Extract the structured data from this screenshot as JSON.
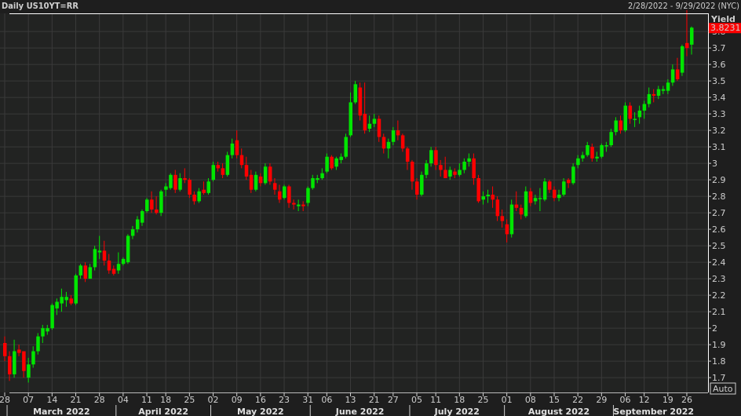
{
  "header": {
    "title": "Daily US10YT=RR",
    "range": "2/28/2022 - 9/29/2022 (NYC)"
  },
  "chart_data": {
    "type": "candlestick",
    "ylabel": "Yield",
    "ylim": [
      1.61,
      3.91
    ],
    "yticks": [
      1.7,
      1.8,
      1.9,
      2,
      2.1,
      2.2,
      2.3,
      2.4,
      2.5,
      2.6,
      2.7,
      2.8,
      2.9,
      3,
      3.1,
      3.2,
      3.3,
      3.4,
      3.5,
      3.6,
      3.7,
      3.8
    ],
    "last_value": "3.8231",
    "scale_mode": "Auto",
    "colors": {
      "up": "#00e600",
      "down": "#ff0000",
      "last_badge": "#ff0000",
      "grid": "#3a3a3a",
      "plot_bg": "#222322"
    },
    "grid": true,
    "columns": [
      "date",
      "open",
      "high",
      "low",
      "close"
    ],
    "candles": [
      [
        "2022-02-28",
        1.91,
        1.95,
        1.8,
        1.83
      ],
      [
        "2022-03-01",
        1.83,
        1.86,
        1.68,
        1.72
      ],
      [
        "2022-03-02",
        1.72,
        1.93,
        1.7,
        1.86
      ],
      [
        "2022-03-03",
        1.87,
        1.9,
        1.83,
        1.85
      ],
      [
        "2022-03-04",
        1.86,
        1.86,
        1.7,
        1.74
      ],
      [
        "2022-03-07",
        1.7,
        1.82,
        1.67,
        1.78
      ],
      [
        "2022-03-08",
        1.78,
        1.89,
        1.76,
        1.86
      ],
      [
        "2022-03-09",
        1.86,
        1.97,
        1.84,
        1.95
      ],
      [
        "2022-03-10",
        1.95,
        2.02,
        1.91,
        2.0
      ],
      [
        "2022-03-11",
        1.98,
        2.02,
        1.96,
        2.0
      ],
      [
        "2022-03-14",
        2.0,
        2.15,
        1.99,
        2.14
      ],
      [
        "2022-03-15",
        2.12,
        2.18,
        2.08,
        2.16
      ],
      [
        "2022-03-16",
        2.15,
        2.24,
        2.1,
        2.19
      ],
      [
        "2022-03-17",
        2.17,
        2.22,
        2.13,
        2.19
      ],
      [
        "2022-03-18",
        2.18,
        2.2,
        2.14,
        2.15
      ],
      [
        "2022-03-21",
        2.15,
        2.33,
        2.14,
        2.32
      ],
      [
        "2022-03-22",
        2.32,
        2.39,
        2.3,
        2.38
      ],
      [
        "2022-03-23",
        2.38,
        2.4,
        2.28,
        2.3
      ],
      [
        "2022-03-24",
        2.3,
        2.39,
        2.3,
        2.37
      ],
      [
        "2022-03-25",
        2.37,
        2.5,
        2.35,
        2.48
      ],
      [
        "2022-03-28",
        2.46,
        2.56,
        2.42,
        2.47
      ],
      [
        "2022-03-29",
        2.47,
        2.53,
        2.38,
        2.41
      ],
      [
        "2022-03-30",
        2.41,
        2.45,
        2.33,
        2.35
      ],
      [
        "2022-03-31",
        2.36,
        2.38,
        2.32,
        2.33
      ],
      [
        "2022-04-01",
        2.35,
        2.46,
        2.33,
        2.39
      ],
      [
        "2022-04-04",
        2.39,
        2.43,
        2.38,
        2.42
      ],
      [
        "2022-04-05",
        2.4,
        2.57,
        2.39,
        2.56
      ],
      [
        "2022-04-06",
        2.56,
        2.62,
        2.54,
        2.6
      ],
      [
        "2022-04-07",
        2.6,
        2.68,
        2.58,
        2.66
      ],
      [
        "2022-04-08",
        2.64,
        2.72,
        2.62,
        2.71
      ],
      [
        "2022-04-11",
        2.71,
        2.79,
        2.7,
        2.78
      ],
      [
        "2022-04-12",
        2.78,
        2.83,
        2.7,
        2.72
      ],
      [
        "2022-04-13",
        2.72,
        2.8,
        2.69,
        2.7
      ],
      [
        "2022-04-14",
        2.7,
        2.84,
        2.68,
        2.83
      ],
      [
        "2022-04-18",
        2.84,
        2.88,
        2.8,
        2.86
      ],
      [
        "2022-04-19",
        2.85,
        2.94,
        2.84,
        2.93
      ],
      [
        "2022-04-20",
        2.93,
        2.96,
        2.82,
        2.84
      ],
      [
        "2022-04-21",
        2.84,
        2.94,
        2.83,
        2.91
      ],
      [
        "2022-04-22",
        2.91,
        2.97,
        2.88,
        2.9
      ],
      [
        "2022-04-25",
        2.9,
        2.91,
        2.79,
        2.81
      ],
      [
        "2022-04-26",
        2.81,
        2.83,
        2.75,
        2.77
      ],
      [
        "2022-04-27",
        2.77,
        2.85,
        2.76,
        2.83
      ],
      [
        "2022-04-28",
        2.84,
        2.89,
        2.81,
        2.82
      ],
      [
        "2022-04-29",
        2.82,
        2.91,
        2.81,
        2.89
      ],
      [
        "2022-05-02",
        2.9,
        3.01,
        2.89,
        2.99
      ],
      [
        "2022-05-03",
        2.99,
        3.01,
        2.95,
        2.97
      ],
      [
        "2022-05-04",
        2.97,
        3.0,
        2.91,
        2.93
      ],
      [
        "2022-05-05",
        2.93,
        3.07,
        2.92,
        3.05
      ],
      [
        "2022-05-06",
        3.05,
        3.15,
        3.03,
        3.12
      ],
      [
        "2022-05-09",
        3.14,
        3.2,
        3.03,
        3.05
      ],
      [
        "2022-05-10",
        3.05,
        3.09,
        2.97,
        2.99
      ],
      [
        "2022-05-11",
        2.99,
        3.04,
        2.9,
        2.92
      ],
      [
        "2022-05-12",
        2.93,
        2.96,
        2.82,
        2.84
      ],
      [
        "2022-05-13",
        2.84,
        2.95,
        2.83,
        2.93
      ],
      [
        "2022-05-16",
        2.92,
        2.94,
        2.86,
        2.88
      ],
      [
        "2022-05-17",
        2.88,
        3.0,
        2.87,
        2.98
      ],
      [
        "2022-05-18",
        2.98,
        3.0,
        2.87,
        2.89
      ],
      [
        "2022-05-19",
        2.88,
        2.91,
        2.81,
        2.84
      ],
      [
        "2022-05-20",
        2.83,
        2.87,
        2.76,
        2.78
      ],
      [
        "2022-05-23",
        2.79,
        2.87,
        2.78,
        2.86
      ],
      [
        "2022-05-24",
        2.86,
        2.87,
        2.73,
        2.76
      ],
      [
        "2022-05-25",
        2.76,
        2.78,
        2.72,
        2.75
      ],
      [
        "2022-05-26",
        2.74,
        2.78,
        2.71,
        2.75
      ],
      [
        "2022-05-27",
        2.75,
        2.77,
        2.71,
        2.74
      ],
      [
        "2022-05-31",
        2.76,
        2.86,
        2.74,
        2.85
      ],
      [
        "2022-06-01",
        2.85,
        2.93,
        2.84,
        2.91
      ],
      [
        "2022-06-02",
        2.9,
        2.93,
        2.88,
        2.91
      ],
      [
        "2022-06-03",
        2.91,
        2.97,
        2.9,
        2.94
      ],
      [
        "2022-06-06",
        2.95,
        3.06,
        2.94,
        3.04
      ],
      [
        "2022-06-07",
        3.04,
        3.05,
        2.96,
        2.97
      ],
      [
        "2022-06-08",
        2.98,
        3.04,
        2.96,
        3.03
      ],
      [
        "2022-06-09",
        3.02,
        3.06,
        3.0,
        3.04
      ],
      [
        "2022-06-10",
        3.04,
        3.18,
        3.03,
        3.16
      ],
      [
        "2022-06-13",
        3.17,
        3.43,
        3.16,
        3.37
      ],
      [
        "2022-06-14",
        3.37,
        3.5,
        3.36,
        3.48
      ],
      [
        "2022-06-15",
        3.46,
        3.49,
        3.26,
        3.29
      ],
      [
        "2022-06-16",
        3.3,
        3.49,
        3.18,
        3.2
      ],
      [
        "2022-06-17",
        3.21,
        3.29,
        3.19,
        3.24
      ],
      [
        "2022-06-21",
        3.24,
        3.3,
        3.22,
        3.27
      ],
      [
        "2022-06-22",
        3.27,
        3.29,
        3.13,
        3.16
      ],
      [
        "2022-06-23",
        3.16,
        3.18,
        3.06,
        3.09
      ],
      [
        "2022-06-24",
        3.09,
        3.15,
        3.03,
        3.13
      ],
      [
        "2022-06-27",
        3.13,
        3.22,
        3.11,
        3.2
      ],
      [
        "2022-06-28",
        3.2,
        3.26,
        3.14,
        3.17
      ],
      [
        "2022-06-29",
        3.17,
        3.18,
        3.07,
        3.09
      ],
      [
        "2022-06-30",
        3.09,
        3.1,
        2.96,
        3.01
      ],
      [
        "2022-07-01",
        3.01,
        3.02,
        2.84,
        2.89
      ],
      [
        "2022-07-05",
        2.89,
        2.91,
        2.78,
        2.81
      ],
      [
        "2022-07-06",
        2.81,
        2.95,
        2.8,
        2.93
      ],
      [
        "2022-07-07",
        2.93,
        3.02,
        2.91,
        3.0
      ],
      [
        "2022-07-08",
        3.0,
        3.1,
        2.98,
        3.08
      ],
      [
        "2022-07-11",
        3.08,
        3.1,
        2.96,
        2.99
      ],
      [
        "2022-07-12",
        2.99,
        3.02,
        2.92,
        2.96
      ],
      [
        "2022-07-13",
        2.96,
        3.04,
        2.91,
        2.91
      ],
      [
        "2022-07-14",
        2.92,
        2.98,
        2.9,
        2.96
      ],
      [
        "2022-07-15",
        2.95,
        2.97,
        2.91,
        2.93
      ],
      [
        "2022-07-18",
        2.93,
        3.0,
        2.92,
        2.96
      ],
      [
        "2022-07-19",
        2.96,
        3.03,
        2.94,
        3.01
      ],
      [
        "2022-07-20",
        3.01,
        3.06,
        2.98,
        3.03
      ],
      [
        "2022-07-21",
        3.03,
        3.06,
        2.87,
        2.91
      ],
      [
        "2022-07-22",
        2.91,
        2.93,
        2.76,
        2.77
      ],
      [
        "2022-07-25",
        2.78,
        2.83,
        2.75,
        2.8
      ],
      [
        "2022-07-26",
        2.8,
        2.84,
        2.76,
        2.81
      ],
      [
        "2022-07-27",
        2.81,
        2.86,
        2.73,
        2.78
      ],
      [
        "2022-07-28",
        2.78,
        2.8,
        2.65,
        2.68
      ],
      [
        "2022-07-29",
        2.68,
        2.72,
        2.61,
        2.65
      ],
      [
        "2022-08-01",
        2.63,
        2.66,
        2.52,
        2.57
      ],
      [
        "2022-08-02",
        2.57,
        2.78,
        2.55,
        2.75
      ],
      [
        "2022-08-03",
        2.75,
        2.83,
        2.71,
        2.73
      ],
      [
        "2022-08-04",
        2.73,
        2.75,
        2.66,
        2.69
      ],
      [
        "2022-08-05",
        2.68,
        2.86,
        2.67,
        2.83
      ],
      [
        "2022-08-08",
        2.83,
        2.85,
        2.74,
        2.76
      ],
      [
        "2022-08-09",
        2.77,
        2.81,
        2.75,
        2.79
      ],
      [
        "2022-08-10",
        2.79,
        2.85,
        2.71,
        2.79
      ],
      [
        "2022-08-11",
        2.78,
        2.91,
        2.77,
        2.89
      ],
      [
        "2022-08-12",
        2.89,
        2.9,
        2.82,
        2.84
      ],
      [
        "2022-08-15",
        2.84,
        2.86,
        2.77,
        2.79
      ],
      [
        "2022-08-16",
        2.79,
        2.84,
        2.77,
        2.81
      ],
      [
        "2022-08-17",
        2.81,
        2.91,
        2.8,
        2.89
      ],
      [
        "2022-08-18",
        2.9,
        2.91,
        2.85,
        2.88
      ],
      [
        "2022-08-19",
        2.88,
        3.0,
        2.87,
        2.98
      ],
      [
        "2022-08-22",
        2.99,
        3.05,
        2.97,
        3.03
      ],
      [
        "2022-08-23",
        3.03,
        3.07,
        3.01,
        3.05
      ],
      [
        "2022-08-24",
        3.05,
        3.13,
        3.04,
        3.11
      ],
      [
        "2022-08-25",
        3.1,
        3.12,
        3.01,
        3.03
      ],
      [
        "2022-08-26",
        3.03,
        3.07,
        3.01,
        3.04
      ],
      [
        "2022-08-29",
        3.04,
        3.12,
        3.03,
        3.11
      ],
      [
        "2022-08-30",
        3.11,
        3.13,
        3.07,
        3.11
      ],
      [
        "2022-08-31",
        3.11,
        3.21,
        3.1,
        3.19
      ],
      [
        "2022-09-01",
        3.19,
        3.28,
        3.17,
        3.26
      ],
      [
        "2022-09-02",
        3.26,
        3.29,
        3.18,
        3.2
      ],
      [
        "2022-09-06",
        3.2,
        3.37,
        3.19,
        3.35
      ],
      [
        "2022-09-07",
        3.35,
        3.37,
        3.24,
        3.27
      ],
      [
        "2022-09-08",
        3.27,
        3.31,
        3.22,
        3.27
      ],
      [
        "2022-09-09",
        3.28,
        3.35,
        3.24,
        3.32
      ],
      [
        "2022-09-12",
        3.32,
        3.38,
        3.27,
        3.36
      ],
      [
        "2022-09-13",
        3.36,
        3.46,
        3.34,
        3.42
      ],
      [
        "2022-09-14",
        3.42,
        3.45,
        3.37,
        3.41
      ],
      [
        "2022-09-15",
        3.41,
        3.47,
        3.39,
        3.45
      ],
      [
        "2022-09-16",
        3.44,
        3.47,
        3.42,
        3.45
      ],
      [
        "2022-09-19",
        3.44,
        3.51,
        3.42,
        3.49
      ],
      [
        "2022-09-20",
        3.49,
        3.6,
        3.47,
        3.57
      ],
      [
        "2022-09-21",
        3.57,
        3.64,
        3.5,
        3.51
      ],
      [
        "2022-09-22",
        3.55,
        3.72,
        3.53,
        3.71
      ],
      [
        "2022-09-26",
        3.73,
        3.93,
        3.65,
        3.7
      ],
      [
        "2022-09-27",
        3.72,
        3.83,
        3.66,
        3.8231
      ]
    ],
    "xticks": [
      {
        "date": "2022-02-28",
        "label": "28"
      },
      {
        "date": "2022-03-07",
        "label": "07"
      },
      {
        "date": "2022-03-14",
        "label": "14"
      },
      {
        "date": "2022-03-21",
        "label": "21"
      },
      {
        "date": "2022-03-28",
        "label": "28"
      },
      {
        "date": "2022-04-04",
        "label": "04"
      },
      {
        "date": "2022-04-11",
        "label": "11"
      },
      {
        "date": "2022-04-18",
        "label": "18"
      },
      {
        "date": "2022-04-25",
        "label": "25"
      },
      {
        "date": "2022-05-02",
        "label": "02"
      },
      {
        "date": "2022-05-09",
        "label": "09"
      },
      {
        "date": "2022-05-16",
        "label": "16"
      },
      {
        "date": "2022-05-23",
        "label": "23"
      },
      {
        "date": "2022-05-31",
        "label": "31"
      },
      {
        "date": "2022-06-06",
        "label": "06"
      },
      {
        "date": "2022-06-13",
        "label": "13"
      },
      {
        "date": "2022-06-21",
        "label": "21"
      },
      {
        "date": "2022-06-27",
        "label": "27"
      },
      {
        "date": "2022-07-05",
        "label": "05"
      },
      {
        "date": "2022-07-11",
        "label": "11"
      },
      {
        "date": "2022-07-18",
        "label": "18"
      },
      {
        "date": "2022-07-25",
        "label": "25"
      },
      {
        "date": "2022-08-01",
        "label": "01"
      },
      {
        "date": "2022-08-08",
        "label": "08"
      },
      {
        "date": "2022-08-15",
        "label": "15"
      },
      {
        "date": "2022-08-22",
        "label": "22"
      },
      {
        "date": "2022-08-29",
        "label": "29"
      },
      {
        "date": "2022-09-06",
        "label": "06"
      },
      {
        "date": "2022-09-12",
        "label": "12"
      },
      {
        "date": "2022-09-19",
        "label": "19"
      },
      {
        "date": "2022-09-26",
        "label": "26"
      }
    ],
    "months": [
      {
        "prefix": "2022-03",
        "label": "March 2022"
      },
      {
        "prefix": "2022-04",
        "label": "April 2022"
      },
      {
        "prefix": "2022-05",
        "label": "May 2022"
      },
      {
        "prefix": "2022-06",
        "label": "June 2022"
      },
      {
        "prefix": "2022-07",
        "label": "July 2022"
      },
      {
        "prefix": "2022-08",
        "label": "August 2022"
      },
      {
        "prefix": "2022-09",
        "label": "September 2022"
      }
    ]
  }
}
